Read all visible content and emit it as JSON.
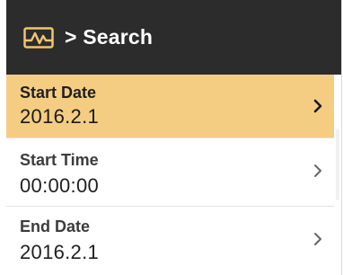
{
  "header": {
    "icon": "activity-chart-icon",
    "title": "> Search"
  },
  "rows": [
    {
      "label": "Start Date",
      "value": "2016.2.1",
      "selected": true,
      "icon": "chevron-right-icon"
    },
    {
      "label": "Start Time",
      "value": "00:00:00",
      "selected": false,
      "icon": "chevron-right-icon"
    },
    {
      "label": "End Date",
      "value": "2016.2.1",
      "selected": false,
      "icon": "chevron-right-icon"
    }
  ],
  "colors": {
    "header_bg": "#2c2c2c",
    "selected_bg": "#f5cd82",
    "icon_accent": "#f2c46f"
  }
}
